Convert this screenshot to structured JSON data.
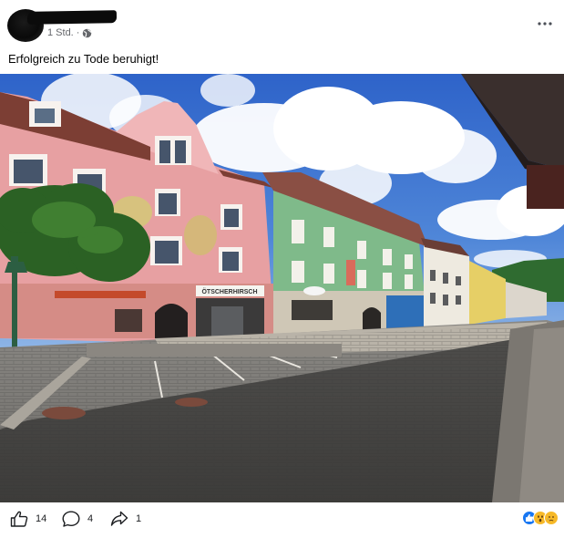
{
  "post": {
    "timestamp": "1 Std.",
    "caption": "Erfolgreich zu Tode beruhigt!",
    "more_icon": "more-dots-icon",
    "audience_icon": "globe-icon"
  },
  "photo": {
    "shop_sign": "ÖTSCHERHIRSCH"
  },
  "footer": {
    "like_count": "14",
    "comment_count": "4",
    "share_count": "1",
    "like_icon": "thumbs-up-icon",
    "comment_icon": "comment-bubble-icon",
    "share_icon": "share-arrow-icon",
    "reactions": [
      "like",
      "wow",
      "sad"
    ],
    "colors": {
      "like": "#1877f2",
      "emoji": "#f7b928"
    }
  }
}
